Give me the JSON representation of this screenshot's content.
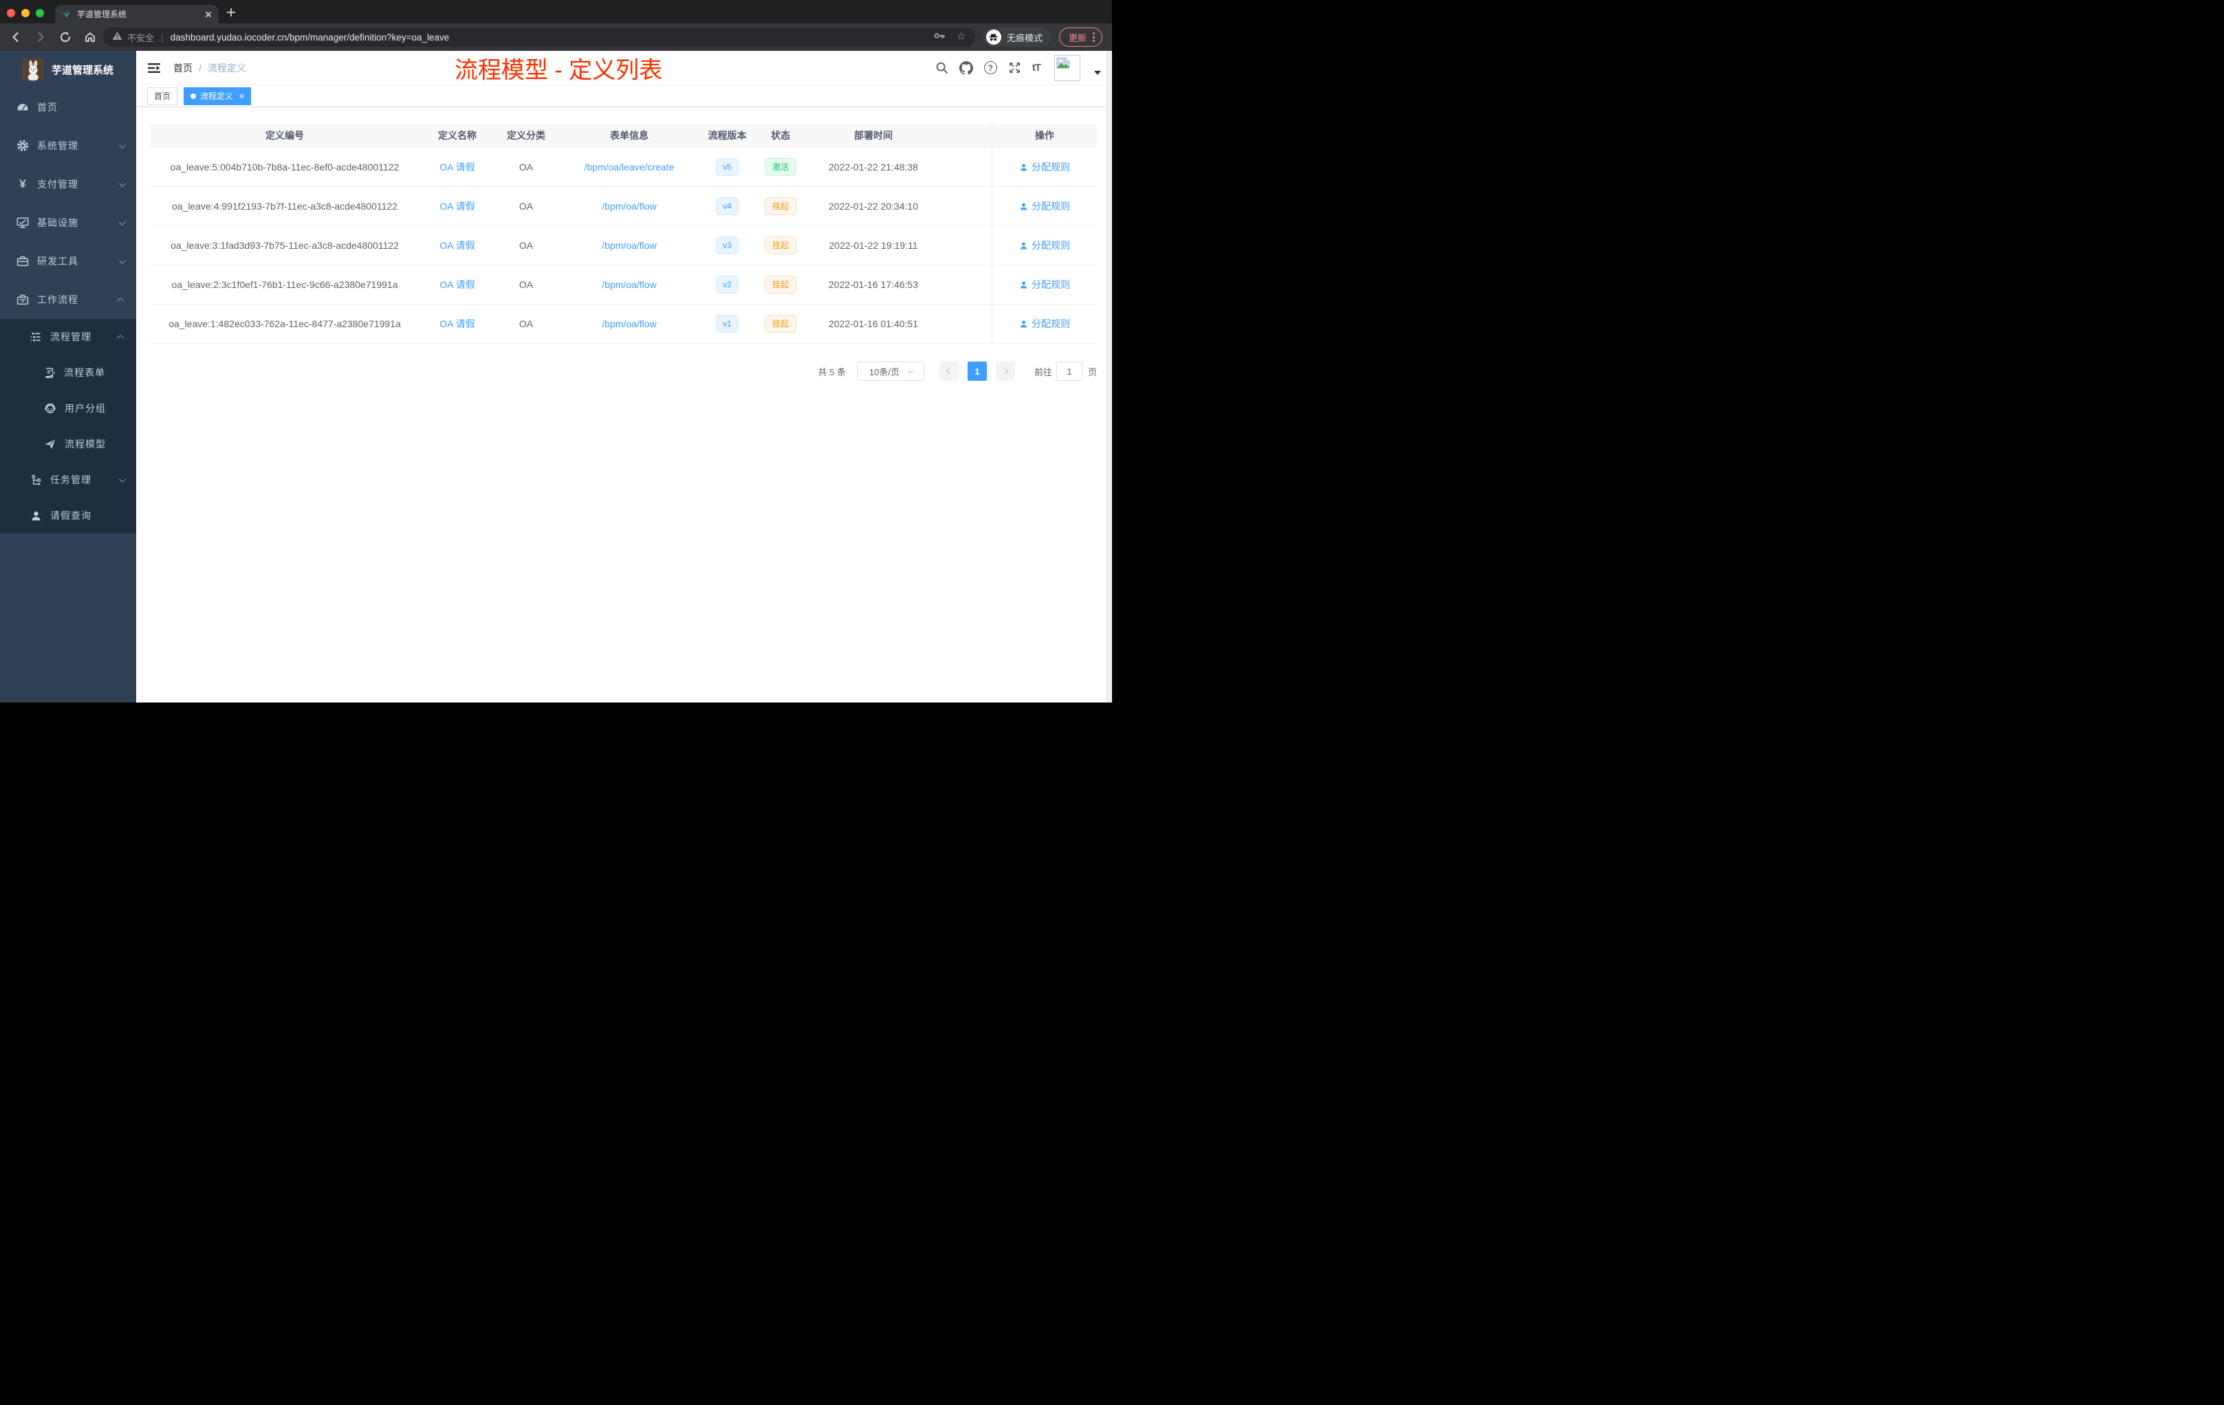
{
  "browser": {
    "tab_title": "芋道管理系统",
    "security_label": "不安全",
    "url": "dashboard.yudao.iocoder.cn/bpm/manager/definition?key=oa_leave",
    "incognito_label": "无痕模式",
    "update_label": "更新",
    "toolbar_icons": [
      "back-icon",
      "forward-icon",
      "reload-icon",
      "home-icon",
      "key-icon",
      "star-icon"
    ]
  },
  "glyphs": {
    "url_separator": "|",
    "star": "☆",
    "yen": "¥",
    "question": "?",
    "font_size": "tT",
    "breadcrumb_separator": "/"
  },
  "sidebar": {
    "logo_title": "芋道管理系统",
    "menu": [
      {
        "label": "首页",
        "icon": "dashboard-icon",
        "chevron": "none"
      },
      {
        "label": "系统管理",
        "icon": "gear-icon",
        "chevron": "down"
      },
      {
        "label": "支付管理",
        "icon": "yen-icon",
        "chevron": "down"
      },
      {
        "label": "基础设施",
        "icon": "monitor-icon",
        "chevron": "down"
      },
      {
        "label": "研发工具",
        "icon": "toolbox-icon",
        "chevron": "down"
      },
      {
        "label": "工作流程",
        "icon": "briefcase-icon",
        "chevron": "up"
      },
      {
        "label": "流程管理",
        "icon": "tree-list-icon",
        "chevron": "up"
      },
      {
        "label": "流程表单",
        "icon": "form-edit-icon",
        "chevron": "none"
      },
      {
        "label": "用户分组",
        "icon": "robot-icon",
        "chevron": "none"
      },
      {
        "label": "流程模型",
        "icon": "paper-plane-icon",
        "chevron": "none"
      },
      {
        "label": "任务管理",
        "icon": "org-tree-icon",
        "chevron": "down"
      },
      {
        "label": "请假查询",
        "icon": "user-icon",
        "chevron": "none"
      }
    ]
  },
  "header": {
    "breadcrumb": [
      "首页",
      "流程定义"
    ],
    "annotation": "流程模型 - 定义列表",
    "annotation_color": "#ff3000",
    "right_icons": [
      "search-icon",
      "github-icon",
      "question-icon",
      "fullscreen-icon",
      "font-size-icon",
      "avatar",
      "caret-down-icon"
    ]
  },
  "tags_view": [
    {
      "label": "首页",
      "active": false
    },
    {
      "label": "流程定义",
      "active": true
    }
  ],
  "table": {
    "columns": [
      "定义编号",
      "定义名称",
      "定义分类",
      "表单信息",
      "流程版本",
      "状态",
      "部署时间",
      "操作"
    ],
    "rows": [
      {
        "id": "oa_leave:5:004b710b-7b8a-11ec-8ef0-acde48001122",
        "name": "OA 请假",
        "category": "OA",
        "form": "/bpm/oa/leave/create",
        "version": "v5",
        "status": "激活",
        "status_type": "success",
        "deploy_time": "2022-01-22 21:48:38",
        "action": "分配规则"
      },
      {
        "id": "oa_leave:4:991f2193-7b7f-11ec-a3c8-acde48001122",
        "name": "OA 请假",
        "category": "OA",
        "form": "/bpm/oa/flow",
        "version": "v4",
        "status": "挂起",
        "status_type": "warning",
        "deploy_time": "2022-01-22 20:34:10",
        "action": "分配规则"
      },
      {
        "id": "oa_leave:3:1fad3d93-7b75-11ec-a3c8-acde48001122",
        "name": "OA 请假",
        "category": "OA",
        "form": "/bpm/oa/flow",
        "version": "v3",
        "status": "挂起",
        "status_type": "warning",
        "deploy_time": "2022-01-22 19:19:11",
        "action": "分配规则"
      },
      {
        "id": "oa_leave:2:3c1f0ef1-76b1-11ec-9c66-a2380e71991a",
        "name": "OA 请假",
        "category": "OA",
        "form": "/bpm/oa/flow",
        "version": "v2",
        "status": "挂起",
        "status_type": "warning",
        "deploy_time": "2022-01-16 17:46:53",
        "action": "分配规则"
      },
      {
        "id": "oa_leave:1:482ec033-762a-11ec-8477-a2380e71991a",
        "name": "OA 请假",
        "category": "OA",
        "form": "/bpm/oa/flow",
        "version": "v1",
        "status": "挂起",
        "status_type": "warning",
        "deploy_time": "2022-01-16 01:40:51",
        "action": "分配规则"
      }
    ]
  },
  "pagination": {
    "total_label": "共 5 条",
    "page_size_label": "10条/页",
    "current_page": "1",
    "goto_label": "前往",
    "goto_value": "1",
    "page_unit": "页"
  },
  "colors": {
    "accent": "#409eff",
    "sidebar_bg": "#304156",
    "submenu_bg": "#1f2d3d",
    "success": "#13ce66",
    "warning": "#ff9900",
    "annotation": "#ff3000"
  }
}
